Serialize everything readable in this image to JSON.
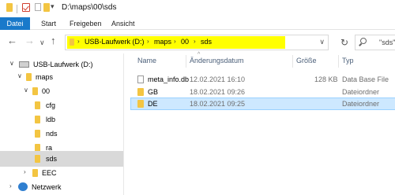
{
  "window": {
    "title": "D:\\maps\\00\\sds"
  },
  "ribbon": {
    "tabs": [
      "Datei",
      "Start",
      "Freigeben",
      "Ansicht"
    ]
  },
  "address": {
    "crumbs": [
      "USB-Laufwerk (D:)",
      "maps",
      "00",
      "sds"
    ],
    "highlight_color": "#ffff00"
  },
  "search": {
    "placeholder": "\"sds\""
  },
  "tree": {
    "items": [
      {
        "label": "USB-Laufwerk (D:)",
        "icon": "drive-icon"
      },
      {
        "label": "maps",
        "icon": "folder-icon"
      },
      {
        "label": "00",
        "icon": "folder-icon"
      },
      {
        "label": "cfg",
        "icon": "folder-icon"
      },
      {
        "label": "ldb",
        "icon": "folder-icon"
      },
      {
        "label": "nds",
        "icon": "folder-icon"
      },
      {
        "label": "ra",
        "icon": "folder-icon"
      },
      {
        "label": "sds",
        "icon": "folder-icon",
        "selected": true
      },
      {
        "label": "EEC",
        "icon": "folder-icon"
      },
      {
        "label": "Netzwerk",
        "icon": "network-icon"
      }
    ]
  },
  "columns": {
    "name": "Name",
    "date": "Änderungsdatum",
    "size": "Größe",
    "type": "Typ"
  },
  "files": [
    {
      "name": "meta_info.db",
      "date": "12.02.2021 16:10",
      "size": "128 KB",
      "type": "Data Base File",
      "icon": "file-icon"
    },
    {
      "name": "GB",
      "date": "18.02.2021 09:26",
      "size": "",
      "type": "Dateiordner",
      "icon": "folder-icon"
    },
    {
      "name": "DE",
      "date": "18.02.2021 09:25",
      "size": "",
      "type": "Dateiordner",
      "icon": "folder-icon",
      "selected": true
    }
  ],
  "colors": {
    "accent": "#1979ca",
    "folder": "#f3c542",
    "selection": "#cde8ff"
  }
}
